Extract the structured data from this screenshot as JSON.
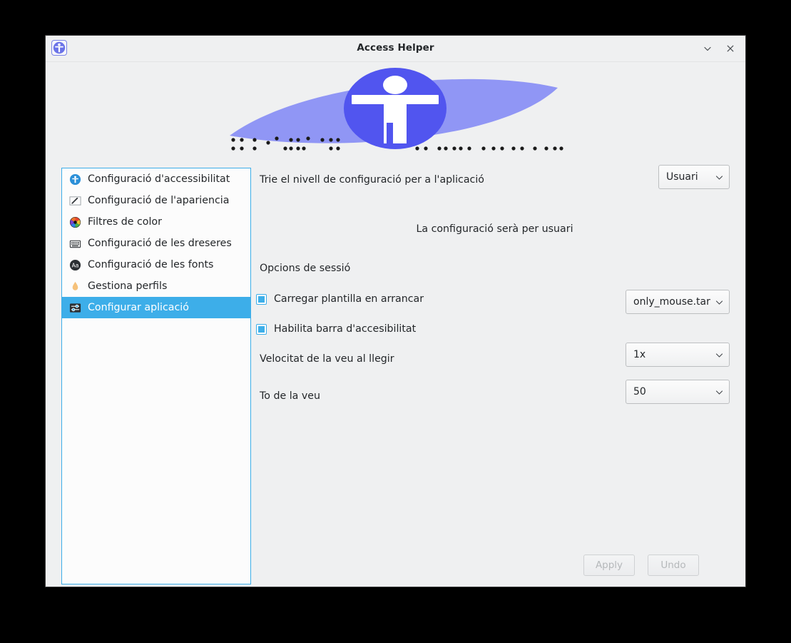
{
  "window": {
    "title": "Access Helper",
    "icon": "accessibility-person-icon",
    "controls": [
      {
        "name": "minimize-button",
        "glyph": "⌄"
      },
      {
        "name": "close-button",
        "glyph": "✕"
      }
    ]
  },
  "banner": {
    "icon": "accessibility-person-icon",
    "decoration": "braille-dots",
    "lens_color": "#9096f5",
    "circle_color": "#5155ef",
    "figure_color": "#ffffff"
  },
  "sidebar": {
    "items": [
      {
        "label": "Configuració d'accessibilitat",
        "icon": "accessibility-icon",
        "selected": false
      },
      {
        "label": "Configuració de l'apariencia",
        "icon": "appearance-pencil-icon",
        "selected": false
      },
      {
        "label": "Filtres de color",
        "icon": "color-wheel-icon",
        "selected": false
      },
      {
        "label": "Configuració de les dreseres",
        "icon": "keyboard-icon",
        "selected": false
      },
      {
        "label": "Configuració de les fonts",
        "icon": "font-aa-icon",
        "selected": false
      },
      {
        "label": "Gestiona perfils",
        "icon": "flame-icon",
        "selected": false
      },
      {
        "label": "Configurar aplicació",
        "icon": "sliders-icon",
        "selected": true
      }
    ],
    "selection_color": "#3daee9"
  },
  "main": {
    "level_label": "Trie el nivell de configuració per a l'aplicació",
    "level_value": "Usuari",
    "level_note": "La configuració serà per usuari",
    "session_section": "Opcions de sessió",
    "checkboxes": [
      {
        "label": "Carregar plantilla en arrancar",
        "checked": true
      },
      {
        "label": "Habilita barra d'accesibilitat",
        "checked": true
      }
    ],
    "template_value": "only_mouse.tar",
    "speed_label": "Velocitat de la veu al llegir",
    "speed_value": "1x",
    "pitch_label": "To de la veu",
    "pitch_value": "50"
  },
  "footer": {
    "apply_label": "Apply",
    "undo_label": "Undo"
  }
}
